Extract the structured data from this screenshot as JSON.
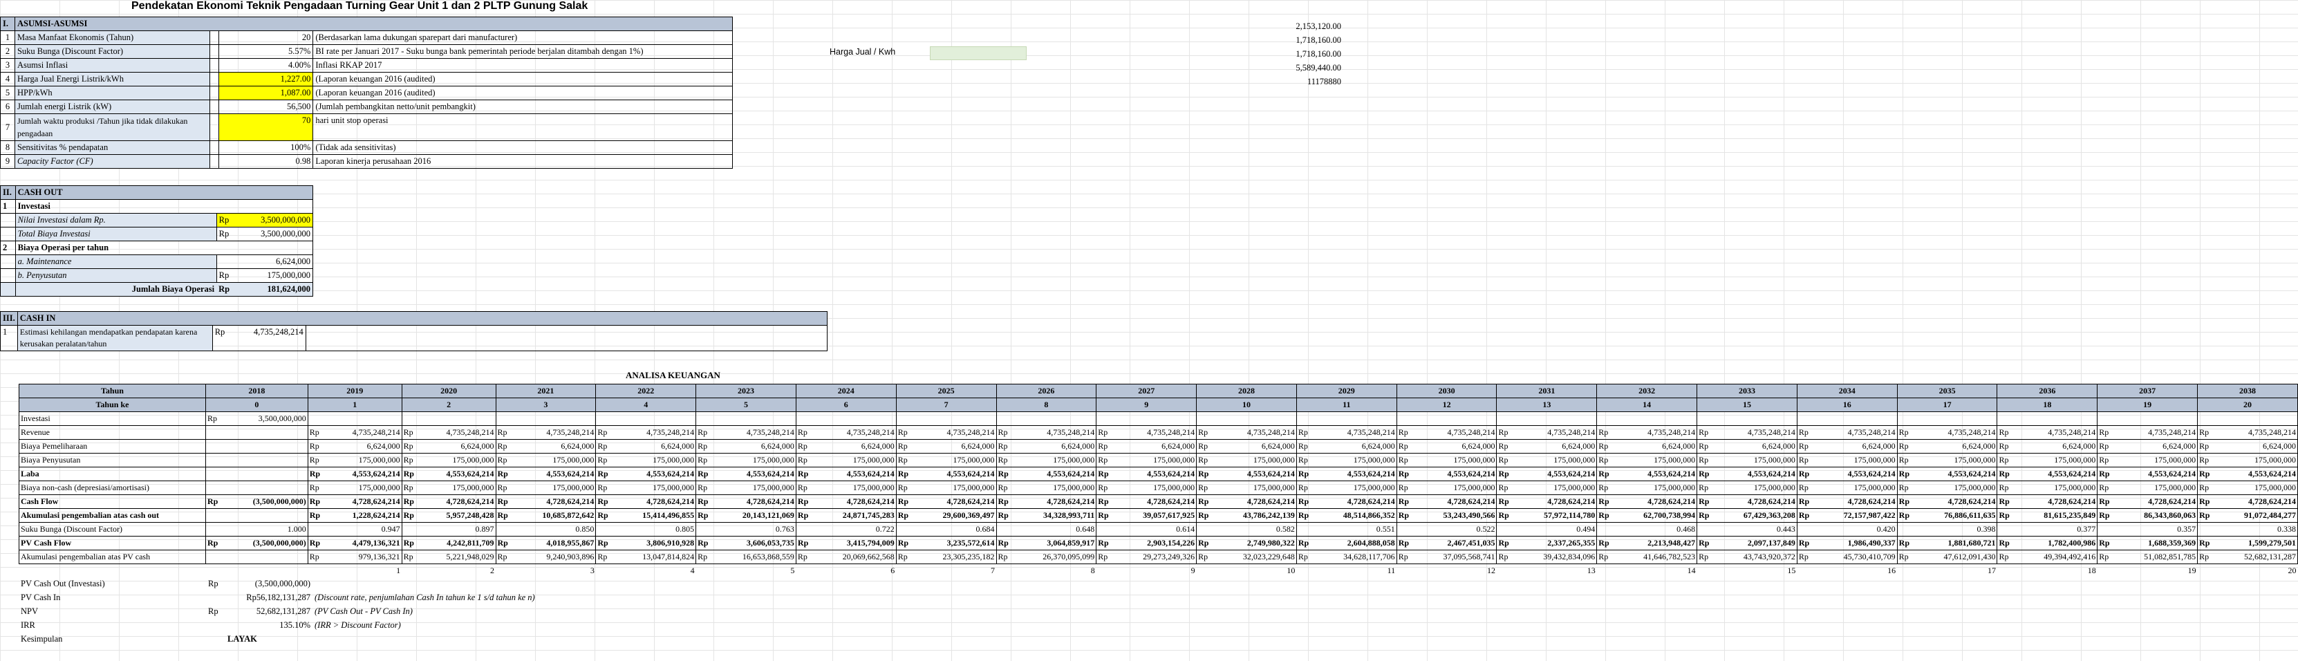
{
  "title": "Pendekatan Ekonomi Teknik Pengadaan Turning Gear Unit 1 dan 2 PLTP Gunung Salak",
  "side_values": [
    "2,153,120.00",
    "1,718,160.00",
    "1,718,160.00",
    "5,589,440.00",
    "11178880"
  ],
  "harga_jual_label": "Harga Jual / Kwh",
  "asumsi": {
    "header_no": "I.",
    "header": "ASUMSI-ASUMSI",
    "rows": [
      {
        "no": "1",
        "label": "Masa Manfaat Ekonomis (Tahun)",
        "value": "20",
        "note": "(Berdasarkan lama dukungan sparepart dari manufacturer)",
        "yellow": false
      },
      {
        "no": "2",
        "label": "Suku Bunga (Discount Factor)",
        "value": "5.57%",
        "note": "BI rate per Januari 2017 - Suku bunga bank pemerintah periode berjalan ditambah dengan 1%)",
        "yellow": false
      },
      {
        "no": "3",
        "label": "Asumsi Inflasi",
        "value": "4.00%",
        "note": "Inflasi RKAP 2017",
        "yellow": false
      },
      {
        "no": "4",
        "label": "Harga Jual Energi Listrik/kWh",
        "value": "1,227.00",
        "note": "(Laporan keuangan 2016 (audited)",
        "yellow": true
      },
      {
        "no": "5",
        "label": "HPP/kWh",
        "value": "1,087.00",
        "note": "(Laporan keuangan 2016 (audited)",
        "yellow": true
      },
      {
        "no": "6",
        "label": "Jumlah energi Listrik (kW)",
        "value": "56,500",
        "note": "(Jumlah pembangkitan netto/unit pembangkit)",
        "yellow": false
      },
      {
        "no": "7",
        "label": "Jumlah waktu produksi /Tahun jika tidak dilakukan pengadaan",
        "value": "70",
        "note": "hari unit stop operasi",
        "yellow": true
      },
      {
        "no": "8",
        "label": "Sensitivitas % pendapatan",
        "value": "100%",
        "note": "(Tidak ada sensitivitas)",
        "yellow": false
      },
      {
        "no": "9",
        "label": "Capacity Factor (CF)",
        "value": "0.98",
        "note": "Laporan kinerja perusahaan 2016",
        "yellow": false
      }
    ]
  },
  "cash_out": {
    "header_no": "II.",
    "header": "CASH OUT",
    "invest_no": "1",
    "invest_label": "Investasi",
    "nilai_label": "Nilai Investasi dalam Rp.",
    "nilai_rp": "Rp",
    "nilai_value": "3,500,000,000",
    "total_label": "Total Biaya Investasi",
    "total_rp": "Rp",
    "total_value": "3,500,000,000",
    "op_no": "2",
    "op_label": "Biaya Operasi per tahun",
    "maint_label": "a. Maintenance",
    "maint_value": "6,624,000",
    "peny_label": "b. Penyusutan",
    "peny_rp": "Rp",
    "peny_value": "175,000,000",
    "jumlah_label": "Jumlah Biaya Operasi",
    "jumlah_sep": ":",
    "jumlah_rp": "Rp",
    "jumlah_value": "181,624,000"
  },
  "cash_in": {
    "header_no": "III.",
    "header": "CASH IN",
    "no": "1",
    "label": "Estimasi kehilangan mendapatkan pendapatan karena kerusakan peralatan/tahun",
    "rp": "Rp",
    "value": "4,735,248,214"
  },
  "analisa": {
    "title": "ANALISA KEUANGAN",
    "tahun_label": "Tahun",
    "tahun_ke_label": "Tahun ke",
    "years": [
      "2018",
      "2019",
      "2020",
      "2021",
      "2022",
      "2023",
      "2024",
      "2025",
      "2026",
      "2027",
      "2028",
      "2029",
      "2030",
      "2031",
      "2032",
      "2033",
      "2034",
      "2035",
      "2036",
      "2037",
      "2038"
    ],
    "year_idx": [
      "0",
      "1",
      "2",
      "3",
      "4",
      "5",
      "6",
      "7",
      "8",
      "9",
      "10",
      "11",
      "12",
      "13",
      "14",
      "15",
      "16",
      "17",
      "18",
      "19",
      "20"
    ],
    "rows": [
      {
        "label": "Investasi",
        "bold": false,
        "first": "3,500,000,000",
        "vals": []
      },
      {
        "label": "Revenue",
        "bold": false,
        "first": "",
        "vals": [
          "4,735,248,214",
          "4,735,248,214",
          "4,735,248,214",
          "4,735,248,214",
          "4,735,248,214",
          "4,735,248,214",
          "4,735,248,214",
          "4,735,248,214",
          "4,735,248,214",
          "4,735,248,214",
          "4,735,248,214",
          "4,735,248,214",
          "4,735,248,214",
          "4,735,248,214",
          "4,735,248,214",
          "4,735,248,214",
          "4,735,248,214",
          "4,735,248,214",
          "4,735,248,214",
          "4,735,248,214"
        ]
      },
      {
        "label": "Biaya Pemeliharaan",
        "bold": false,
        "first": "",
        "vals": [
          "6,624,000",
          "6,624,000",
          "6,624,000",
          "6,624,000",
          "6,624,000",
          "6,624,000",
          "6,624,000",
          "6,624,000",
          "6,624,000",
          "6,624,000",
          "6,624,000",
          "6,624,000",
          "6,624,000",
          "6,624,000",
          "6,624,000",
          "6,624,000",
          "6,624,000",
          "6,624,000",
          "6,624,000",
          "6,624,000"
        ]
      },
      {
        "label": "Biaya Penyusutan",
        "bold": false,
        "first": "",
        "vals": [
          "175,000,000",
          "175,000,000",
          "175,000,000",
          "175,000,000",
          "175,000,000",
          "175,000,000",
          "175,000,000",
          "175,000,000",
          "175,000,000",
          "175,000,000",
          "175,000,000",
          "175,000,000",
          "175,000,000",
          "175,000,000",
          "175,000,000",
          "175,000,000",
          "175,000,000",
          "175,000,000",
          "175,000,000",
          "175,000,000"
        ]
      },
      {
        "label": "Laba",
        "bold": true,
        "first": "",
        "vals": [
          "4,553,624,214",
          "4,553,624,214",
          "4,553,624,214",
          "4,553,624,214",
          "4,553,624,214",
          "4,553,624,214",
          "4,553,624,214",
          "4,553,624,214",
          "4,553,624,214",
          "4,553,624,214",
          "4,553,624,214",
          "4,553,624,214",
          "4,553,624,214",
          "4,553,624,214",
          "4,553,624,214",
          "4,553,624,214",
          "4,553,624,214",
          "4,553,624,214",
          "4,553,624,214",
          "4,553,624,214"
        ]
      },
      {
        "label": "Biaya non-cash (depresiasi/amortisasi)",
        "bold": false,
        "first": "",
        "vals": [
          "175,000,000",
          "175,000,000",
          "175,000,000",
          "175,000,000",
          "175,000,000",
          "175,000,000",
          "175,000,000",
          "175,000,000",
          "175,000,000",
          "175,000,000",
          "175,000,000",
          "175,000,000",
          "175,000,000",
          "175,000,000",
          "175,000,000",
          "175,000,000",
          "175,000,000",
          "175,000,000",
          "175,000,000",
          "175,000,000"
        ]
      },
      {
        "label": "Cash Flow",
        "bold": true,
        "first": "(3,500,000,000)",
        "vals": [
          "4,728,624,214",
          "4,728,624,214",
          "4,728,624,214",
          "4,728,624,214",
          "4,728,624,214",
          "4,728,624,214",
          "4,728,624,214",
          "4,728,624,214",
          "4,728,624,214",
          "4,728,624,214",
          "4,728,624,214",
          "4,728,624,214",
          "4,728,624,214",
          "4,728,624,214",
          "4,728,624,214",
          "4,728,624,214",
          "4,728,624,214",
          "4,728,624,214",
          "4,728,624,214",
          "4,728,624,214"
        ]
      },
      {
        "label": "Akumulasi pengembalian atas cash out",
        "bold": true,
        "first": "",
        "vals": [
          "1,228,624,214",
          "5,957,248,428",
          "10,685,872,642",
          "15,414,496,855",
          "20,143,121,069",
          "24,871,745,283",
          "29,600,369,497",
          "34,328,993,711",
          "39,057,617,925",
          "43,786,242,139",
          "48,514,866,352",
          "53,243,490,566",
          "57,972,114,780",
          "62,700,738,994",
          "67,429,363,208",
          "72,157,987,422",
          "76,886,611,635",
          "81,615,235,849",
          "86,343,860,063",
          "91,072,484,277"
        ]
      },
      {
        "label": "Suku Bunga (Discount Factor)",
        "bold": false,
        "first": "1.000",
        "norp": true,
        "vals": [
          "0.947",
          "0.897",
          "0.850",
          "0.805",
          "0.763",
          "0.722",
          "0.684",
          "0.648",
          "0.614",
          "0.582",
          "0.551",
          "0.522",
          "0.494",
          "0.468",
          "0.443",
          "0.420",
          "0.398",
          "0.377",
          "0.357",
          "0.338"
        ]
      },
      {
        "label": "PV Cash Flow",
        "bold": true,
        "first": "(3,500,000,000)",
        "vals": [
          "4,479,136,321",
          "4,242,811,709",
          "4,018,955,867",
          "3,806,910,928",
          "3,606,053,735",
          "3,415,794,009",
          "3,235,572,614",
          "3,064,859,917",
          "2,903,154,226",
          "2,749,980,322",
          "2,604,888,058",
          "2,467,451,035",
          "2,337,265,355",
          "2,213,948,427",
          "2,097,137,849",
          "1,986,490,337",
          "1,881,680,721",
          "1,782,400,986",
          "1,688,359,369",
          "1,599,279,501"
        ]
      },
      {
        "label": "Akumulasi pengembalian atas PV cash",
        "bold": false,
        "first": "",
        "vals": [
          "979,136,321",
          "5,221,948,029",
          "9,240,903,896",
          "13,047,814,824",
          "16,653,868,559",
          "20,069,662,568",
          "23,305,235,182",
          "26,370,095,099",
          "29,273,249,326",
          "32,023,229,648",
          "34,628,117,706",
          "37,095,568,741",
          "39,432,834,096",
          "41,646,782,523",
          "43,743,920,372",
          "45,730,410,709",
          "47,612,091,430",
          "49,394,492,416",
          "51,082,851,785",
          "52,682,131,287"
        ]
      }
    ],
    "footer_idx": [
      "1",
      "2",
      "3",
      "4",
      "5",
      "6",
      "7",
      "8",
      "9",
      "10",
      "11",
      "12",
      "13",
      "14",
      "15",
      "16",
      "17",
      "18",
      "19",
      "20"
    ]
  },
  "summary": [
    {
      "label": "PV Cash Out (Investasi)",
      "rp": "Rp",
      "value": "(3,500,000,000)",
      "note": ""
    },
    {
      "label": "PV Cash In",
      "rp": "",
      "value": "Rp56,182,131,287",
      "note": "(Discount rate, penjumlahan Cash  In tahun ke 1 s/d tahun ke n)"
    },
    {
      "label": "NPV",
      "rp": "Rp",
      "value": "52,682,131,287",
      "note": "(PV Cash Out - PV Cash In)"
    },
    {
      "label": "IRR",
      "rp": "",
      "value": "135.10%",
      "note": "(IRR > Discount Factor)"
    },
    {
      "label": "Kesimpulan",
      "rp": "",
      "value": "LAYAK",
      "note": ""
    }
  ]
}
